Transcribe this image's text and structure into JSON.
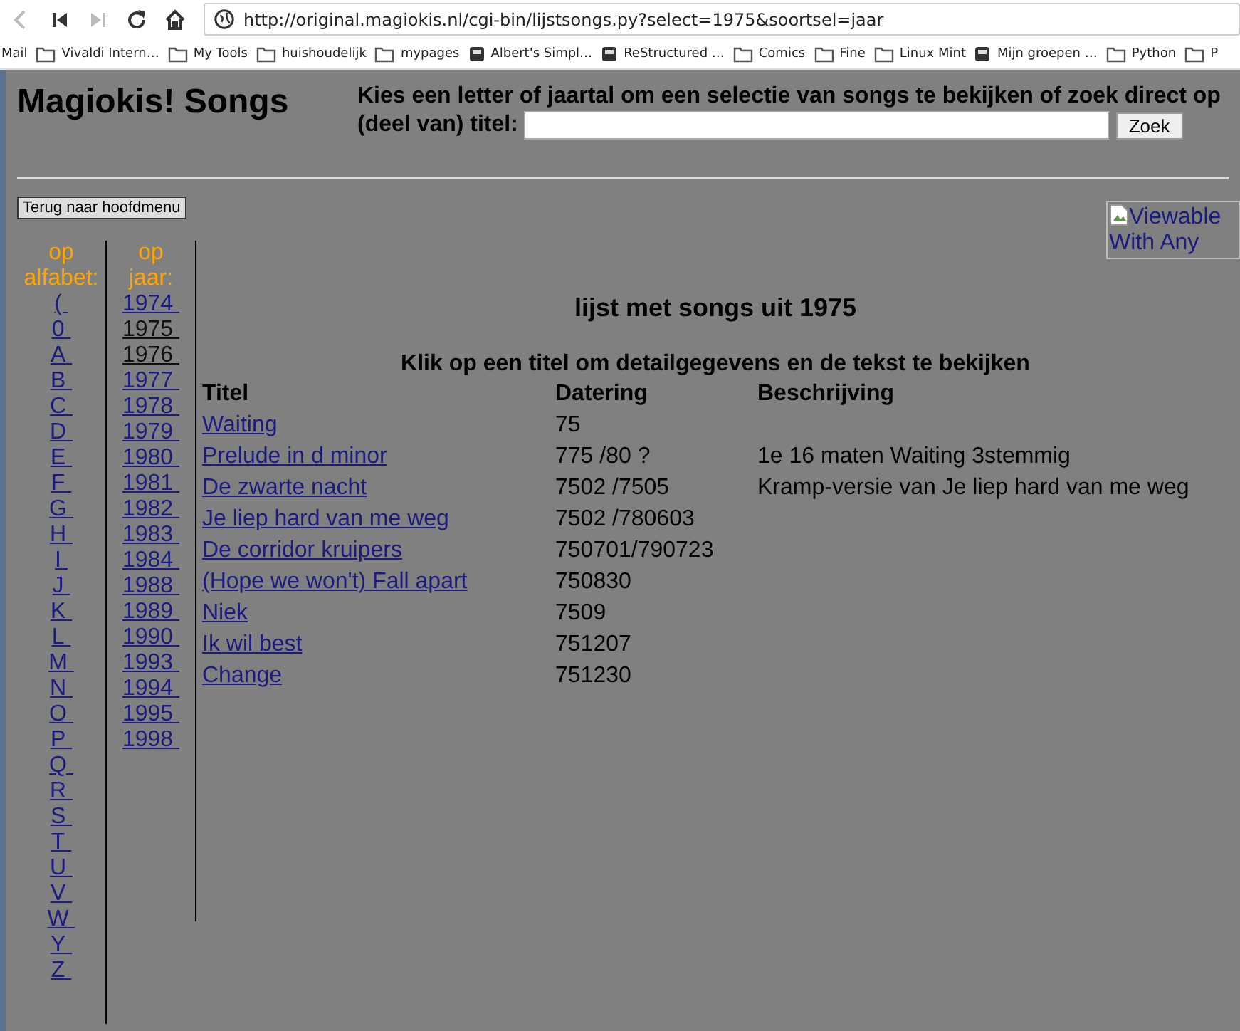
{
  "browser": {
    "nav": [
      {
        "kind": "back",
        "disabled": true
      },
      {
        "kind": "first",
        "disabled": false
      },
      {
        "kind": "next",
        "disabled": true
      },
      {
        "kind": "reload",
        "disabled": false
      },
      {
        "kind": "home",
        "disabled": false
      }
    ],
    "address": "http://original.magiokis.nl/cgi-bin/lijstsongs.py?select=1975&soortsel=jaar",
    "bookmarks": [
      {
        "label": "Mail",
        "kind": "text"
      },
      {
        "label": "Vivaldi Intern…",
        "kind": "folder"
      },
      {
        "label": "My Tools",
        "kind": "folder"
      },
      {
        "label": "huishoudelijk",
        "kind": "folder"
      },
      {
        "label": "mypages",
        "kind": "folder"
      },
      {
        "label": "Albert's Simpl…",
        "kind": "site"
      },
      {
        "label": "ReStructured …",
        "kind": "site"
      },
      {
        "label": "Comics",
        "kind": "folder"
      },
      {
        "label": "Fine",
        "kind": "folder"
      },
      {
        "label": "Linux Mint",
        "kind": "folder"
      },
      {
        "label": "Mijn groepen …",
        "kind": "site"
      },
      {
        "label": "Python",
        "kind": "folder"
      },
      {
        "label": "P",
        "kind": "folder"
      }
    ]
  },
  "page": {
    "title": "Magiokis! Songs",
    "search": {
      "prompt": "Kies een letter of jaartal om een selectie van songs te bekijken of zoek direct op",
      "label": "(deel van) titel:",
      "button": "Zoek"
    },
    "back_button": "Terug naar hoofdmenu",
    "badge_alt": "Viewable With Any",
    "alphabet": {
      "heading": "op alfabet:",
      "links": [
        {
          "label": "("
        },
        {
          "label": "0"
        },
        {
          "label": "A"
        },
        {
          "label": "B"
        },
        {
          "label": "C"
        },
        {
          "label": "D"
        },
        {
          "label": "E"
        },
        {
          "label": "F"
        },
        {
          "label": "G"
        },
        {
          "label": "H"
        },
        {
          "label": "I"
        },
        {
          "label": "J"
        },
        {
          "label": "K"
        },
        {
          "label": "L"
        },
        {
          "label": "M"
        },
        {
          "label": "N"
        },
        {
          "label": "O"
        },
        {
          "label": "P"
        },
        {
          "label": "Q"
        },
        {
          "label": "R"
        },
        {
          "label": "S"
        },
        {
          "label": "T"
        },
        {
          "label": "U"
        },
        {
          "label": "V"
        },
        {
          "label": "W"
        },
        {
          "label": "Y"
        },
        {
          "label": "Z"
        }
      ]
    },
    "years": {
      "heading": "op jaar:",
      "links": [
        {
          "label": "1974",
          "visited": false
        },
        {
          "label": "1975",
          "visited": true
        },
        {
          "label": "1976",
          "visited": true
        },
        {
          "label": "1977",
          "visited": false
        },
        {
          "label": "1978",
          "visited": false
        },
        {
          "label": "1979",
          "visited": false
        },
        {
          "label": "1980",
          "visited": false
        },
        {
          "label": "1981",
          "visited": false
        },
        {
          "label": "1982",
          "visited": false
        },
        {
          "label": "1983",
          "visited": false
        },
        {
          "label": "1984",
          "visited": false
        },
        {
          "label": "1988",
          "visited": false
        },
        {
          "label": "1989",
          "visited": false
        },
        {
          "label": "1990",
          "visited": false
        },
        {
          "label": "1993",
          "visited": false
        },
        {
          "label": "1994",
          "visited": false
        },
        {
          "label": "1995",
          "visited": false
        },
        {
          "label": "1998",
          "visited": false
        }
      ]
    },
    "list_title": "lijst met songs uit 1975",
    "instruction": "Klik op een titel om detailgegevens en de tekst te bekijken",
    "table": {
      "columns": [
        "Titel",
        "Datering",
        "Beschrijving"
      ],
      "rows": [
        {
          "title": "Waiting",
          "date": "75"
        },
        {
          "title": "Prelude in d minor",
          "date": "775 /80 ?",
          "description": "1e 16 maten Waiting 3stemmig"
        },
        {
          "title": "De zwarte nacht",
          "date": "7502 /7505",
          "description": "Kramp-versie van Je liep hard van me weg"
        },
        {
          "title": "Je liep hard van me weg",
          "date": "7502 /780603"
        },
        {
          "title": "De corridor kruipers",
          "date": "750701/790723"
        },
        {
          "title": "(Hope we won't) Fall apart",
          "date": "750830"
        },
        {
          "title": "Niek",
          "date": "7509"
        },
        {
          "title": "Ik wil best",
          "date": "751207"
        },
        {
          "title": "Change",
          "date": "751230"
        }
      ]
    }
  }
}
